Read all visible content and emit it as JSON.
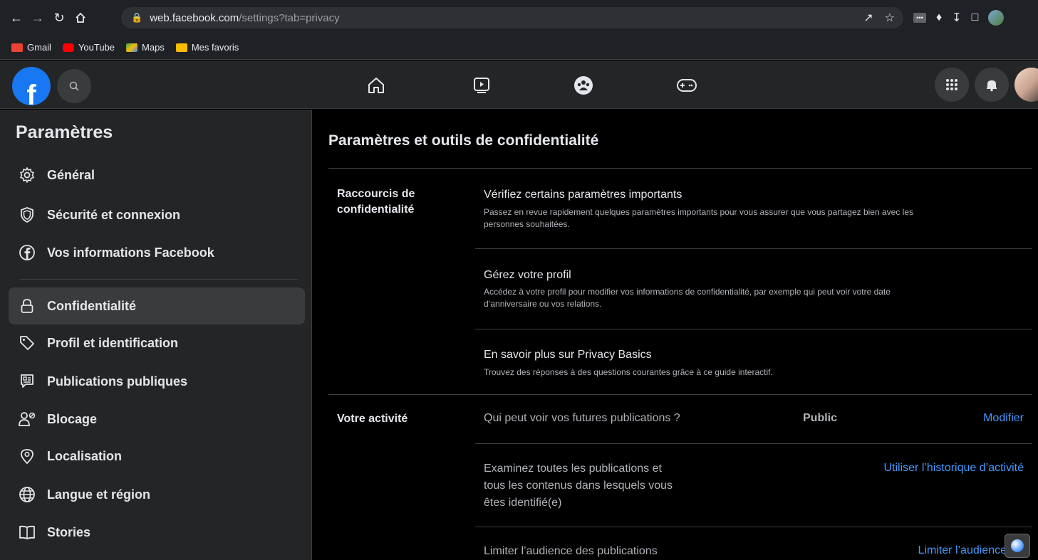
{
  "browser": {
    "url_host": "web.facebook.com",
    "url_path": "/settings?tab=privacy",
    "bookmarks": [
      {
        "label": "Gmail",
        "color": "#ea4335"
      },
      {
        "label": "YouTube",
        "color": "#ff0000"
      },
      {
        "label": "Maps",
        "color": "#34a853"
      },
      {
        "label": "Mes favoris",
        "color": "#fbbc04"
      }
    ]
  },
  "sidebar": {
    "title": "Paramètres",
    "items": [
      {
        "label": "Général",
        "icon": "gear-icon"
      },
      {
        "label": "Sécurité et connexion",
        "icon": "shield-icon"
      },
      {
        "label": "Vos informations Facebook",
        "icon": "facebook-circle-icon"
      },
      {
        "label": "Confidentialité",
        "icon": "lock-icon"
      },
      {
        "label": "Profil et identification",
        "icon": "tag-icon"
      },
      {
        "label": "Publications publiques",
        "icon": "feed-icon"
      },
      {
        "label": "Blocage",
        "icon": "block-user-icon"
      },
      {
        "label": "Localisation",
        "icon": "location-pin-icon"
      },
      {
        "label": "Langue et région",
        "icon": "globe-icon"
      },
      {
        "label": "Stories",
        "icon": "book-icon"
      }
    ]
  },
  "main": {
    "title": "Paramètres et outils de confidentialité",
    "shortcuts": {
      "label_line1": "Raccourcis de",
      "label_line2": "confidentialité",
      "options": [
        {
          "title": "Vérifiez certains paramètres importants",
          "desc_line1": "Passez en revue rapidement quelques paramètres importants pour vous assurer que vous partagez bien avec les",
          "desc_line2": "personnes souhaitées."
        },
        {
          "title": "Gérez votre profil",
          "desc_line1": "Accédez à votre profil pour modifier vos informations de confidentialité, par exemple qui peut voir votre date",
          "desc_line2": "d’anniversaire ou vos relations."
        },
        {
          "title": "En savoir plus sur Privacy Basics",
          "desc_line1": "Trouvez des réponses à des questions courantes grâce à ce guide interactif.",
          "desc_line2": ""
        }
      ]
    },
    "activity": {
      "label": "Votre activité",
      "rows": [
        {
          "text": "Qui peut voir vos futures publications ?",
          "value": "Public",
          "action": "Modifier"
        },
        {
          "line1": "Examinez toutes les publications et",
          "line2": "tous les contenus dans lesquels vous",
          "line3": "êtes identifié(e)",
          "action": "Utiliser l’historique d’activité"
        },
        {
          "text": "Limiter l’audience des publications",
          "action": "Limiter l’audience"
        }
      ]
    }
  },
  "colors": {
    "accent": "#1877f2",
    "link": "#4599ff"
  }
}
